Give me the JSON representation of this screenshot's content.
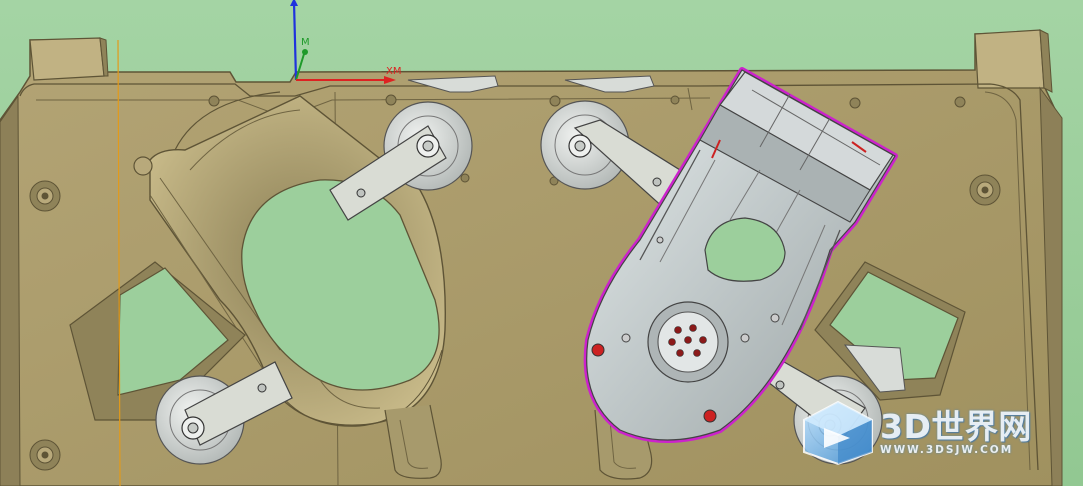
{
  "viewport": {
    "background": "#9ccf9c",
    "plate_color": "#a99a6e",
    "plate_dark": "#7f7250",
    "part_gray": "#c9cfcf",
    "part_edge": "#cc22cc"
  },
  "triad": {
    "y_axis_color": "#1f33dd",
    "z_axis_color": "#1f9a2a",
    "x_axis_color": "#dd2222",
    "z_label": "M",
    "x_label": "XM"
  },
  "watermark": {
    "title": "3D世界网",
    "url": "WWW.3DSJW.COM",
    "logo": "3d-cube-logo-icon"
  }
}
